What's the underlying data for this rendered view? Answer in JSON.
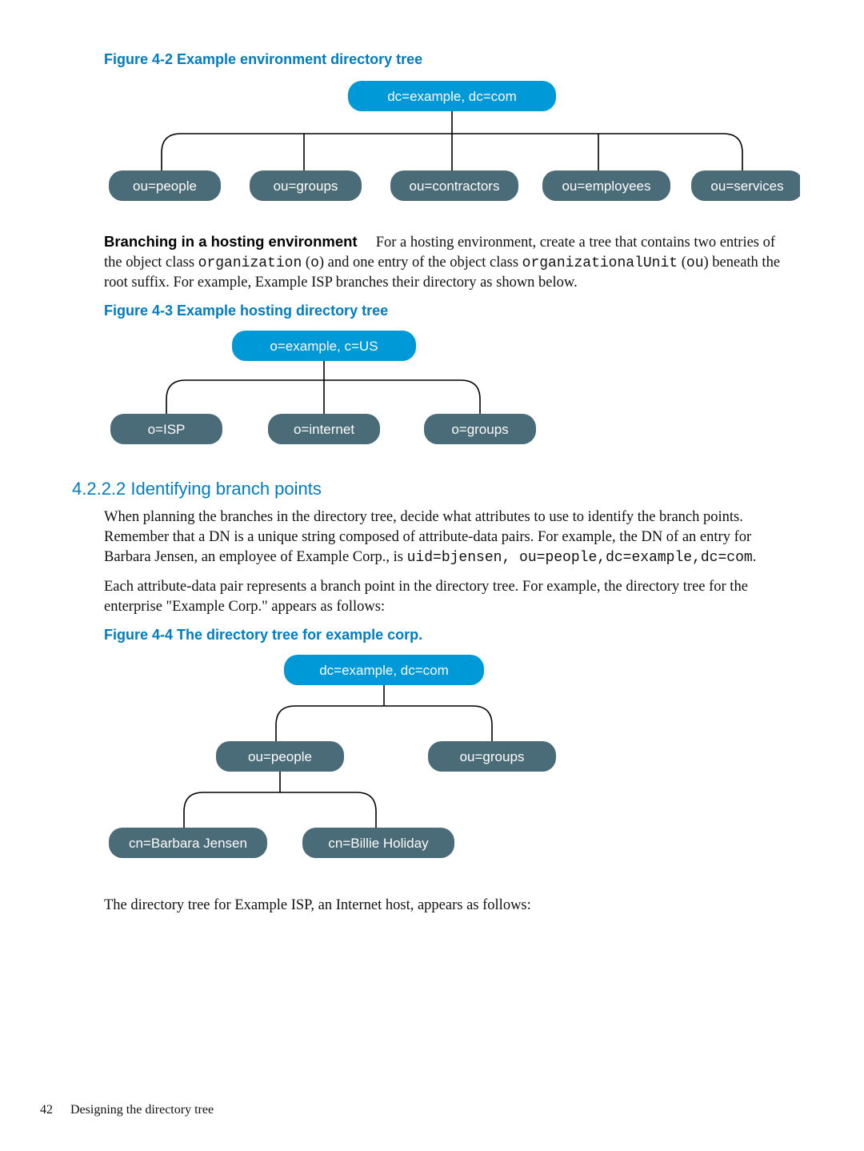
{
  "figures": {
    "f42": {
      "caption": "Figure 4-2 Example environment directory tree",
      "root": "dc=example, dc=com",
      "children": [
        "ou=people",
        "ou=groups",
        "ou=contractors",
        "ou=employees",
        "ou=services"
      ]
    },
    "f43": {
      "caption": "Figure 4-3 Example hosting directory tree",
      "root": "o=example, c=US",
      "children": [
        "o=ISP",
        "o=internet",
        "o=groups"
      ]
    },
    "f44": {
      "caption": "Figure 4-4 The directory tree for example corp.",
      "root": "dc=example, dc=com",
      "level2": [
        "ou=people",
        "ou=groups"
      ],
      "level3": [
        "cn=Barbara Jensen",
        "cn=Billie Holiday"
      ]
    }
  },
  "para1": {
    "runin": "Branching in a hosting environment",
    "t1": "For a hosting environment, create a tree that contains two entries of the object class ",
    "c1": "organization",
    "t2": " (",
    "c2": "o",
    "t3": ") and one entry of the object class ",
    "c3": "organizationalUnit",
    "t4": " (",
    "c4": "ou",
    "t5": ") beneath the root suffix. For example, Example ISP branches their directory as shown below."
  },
  "section": {
    "num": "4.2.2.2",
    "title": " Identifying branch points"
  },
  "para2": {
    "t1": "When planning the branches in the directory tree, decide what attributes to use to identify the branch points. Remember that a DN is a unique string composed of attribute-data pairs. For example, the DN of an entry for Barbara Jensen, an employee of Example Corp., is ",
    "c1": "uid=bjensen, ou=people,dc=example,dc=com",
    "t2": "."
  },
  "para3": "Each attribute-data pair represents a branch point in the directory tree. For example, the directory tree for the enterprise \"Example Corp.\" appears as follows:",
  "para4": "The directory tree for Example ISP, an Internet host, appears as follows:",
  "footer": {
    "page": "42",
    "title": "Designing the directory tree"
  },
  "colors": {
    "brightBlue": "#0099d8",
    "darkTeal": "#4a6b78",
    "headingBlue": "#007cc0"
  }
}
